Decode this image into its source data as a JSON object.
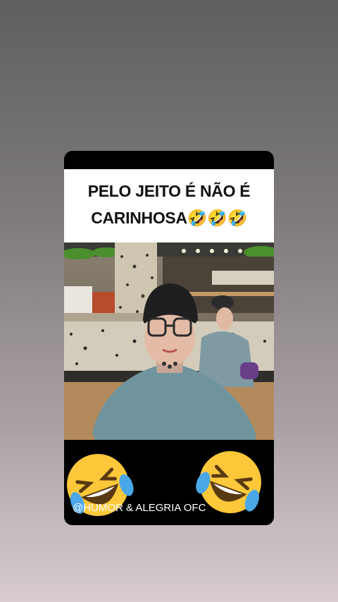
{
  "caption": {
    "line1": "PELO JEITO É NÃO É",
    "line2_text": "CARINHOSA",
    "line2_emojis": "🤣🤣🤣"
  },
  "video": {
    "description_icon": "video-frame"
  },
  "footer": {
    "watermark": "@HUMOR & ALEGRIA OFC",
    "left_emoji_icon": "rolling-laughing-emoji",
    "right_emoji_icon": "rolling-laughing-emoji"
  },
  "colors": {
    "card_bg": "#000000",
    "caption_bg": "#ffffff",
    "emoji_yellow": "#ffc83a",
    "tear_blue": "#4aa8e8"
  }
}
